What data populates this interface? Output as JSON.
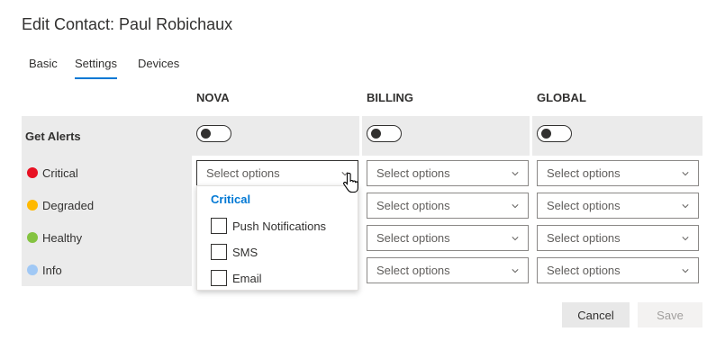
{
  "title": "Edit Contact: Paul Robichaux",
  "tabs": {
    "basic": "Basic",
    "settings": "Settings",
    "devices": "Devices"
  },
  "columns": {
    "nova": "NOVA",
    "billing": "BILLING",
    "global": "GLOBAL"
  },
  "get_alerts_label": "Get Alerts",
  "levels": [
    {
      "label": "Critical",
      "color": "#e81123"
    },
    {
      "label": "Degraded",
      "color": "#ffb900"
    },
    {
      "label": "Healthy",
      "color": "#84c341"
    },
    {
      "label": "Info",
      "color": "#a0c8f5"
    }
  ],
  "select_placeholder": "Select options",
  "dropdown": {
    "header": "Critical",
    "options": [
      "Push Notifications",
      "SMS",
      "Email"
    ]
  },
  "buttons": {
    "cancel": "Cancel",
    "save": "Save"
  }
}
